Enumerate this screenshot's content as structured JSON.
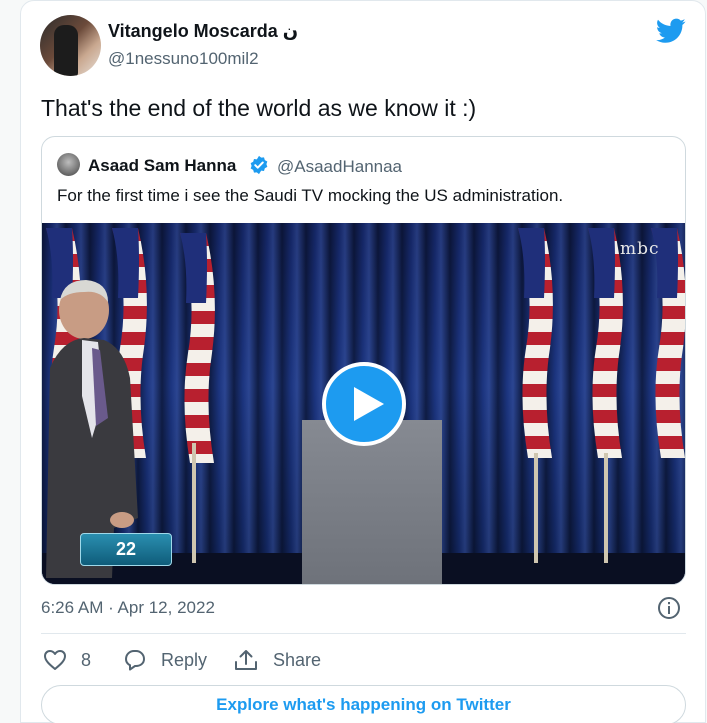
{
  "tweet": {
    "author": {
      "display_name": "Vitangelo Moscarda ن",
      "username": "@1nessuno100mil2"
    },
    "text": "That's the end of the world as we know it :)",
    "timestamp": "6:26 AM · Apr 12, 2022"
  },
  "quoted_tweet": {
    "author": {
      "display_name": "Asaad Sam Hanna",
      "username": "@AsaadHannaa",
      "verified": true
    },
    "text": "For the first time i see the Saudi TV mocking the US administration.",
    "video": {
      "station_logo": "mbc",
      "show_badge": "22"
    }
  },
  "actions": {
    "like_count": "8",
    "reply_label": "Reply",
    "share_label": "Share"
  },
  "footer": {
    "explore_label": "Explore what's happening on Twitter"
  },
  "icons": [
    "twitter-bird-icon",
    "verified-badge-icon",
    "play-icon",
    "info-icon",
    "heart-icon",
    "reply-bubble-icon",
    "share-icon"
  ],
  "colors": {
    "accent": "#1d9bf0",
    "text_primary": "#0f1419",
    "text_secondary": "#536471",
    "border": "#cfd9de"
  }
}
